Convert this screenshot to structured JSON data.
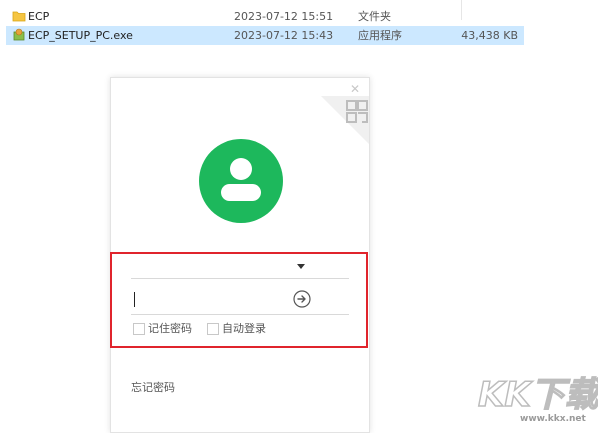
{
  "explorer": {
    "files": [
      {
        "name": "ECP",
        "modified": "2023-07-12 15:51",
        "type": "文件夹",
        "size": "",
        "icon": "folder-icon",
        "selected": false
      },
      {
        "name": "ECP_SETUP_PC.exe",
        "modified": "2023-07-12 15:43",
        "type": "应用程序",
        "size": "43,438 KB",
        "icon": "installer-icon",
        "selected": true
      }
    ]
  },
  "login": {
    "close_symbol": "✕",
    "account_value": "",
    "password_value": "",
    "remember_password_label": "记住密码",
    "auto_login_label": "自动登录",
    "forgot_password_label": "忘记密码"
  },
  "watermark": {
    "brand": "KK下载",
    "url": "www.kkx.net"
  },
  "colors": {
    "avatar_green": "#1db85c",
    "highlight_red": "#e0242c",
    "selection_blue": "#cce8ff"
  }
}
